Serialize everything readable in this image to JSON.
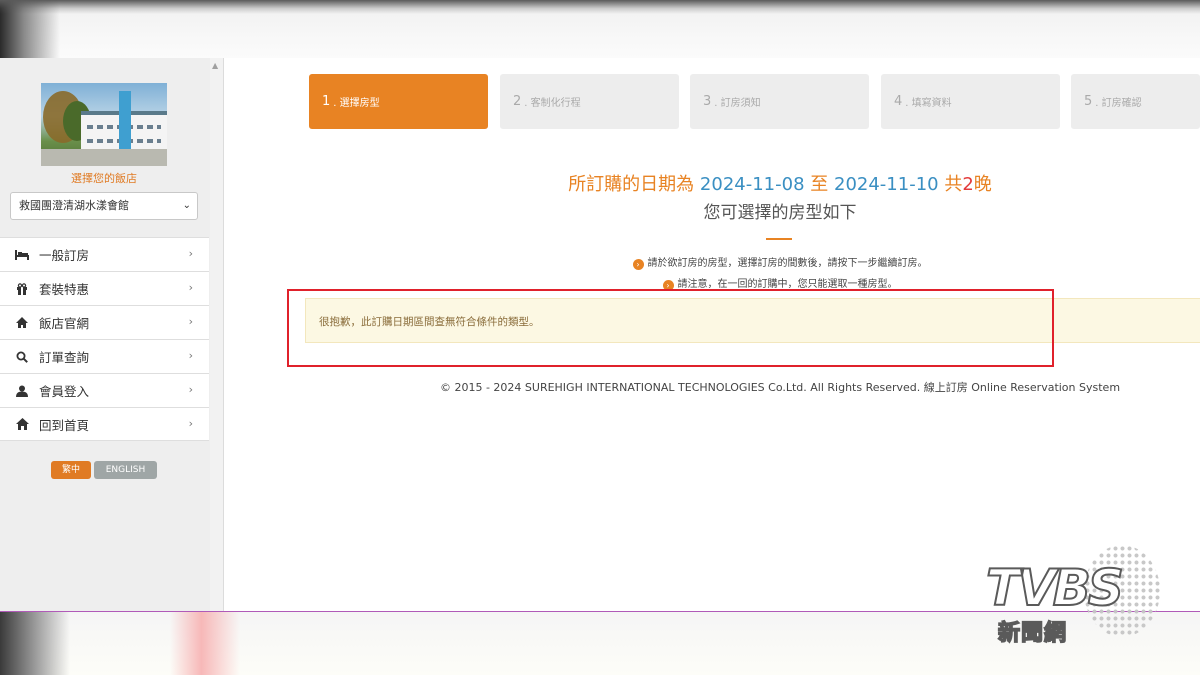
{
  "sidebar": {
    "choose_hotel_label": "選擇您的飯店",
    "selected_hotel": "救國團澄清湖水漾會館",
    "menu": [
      {
        "label": "一般訂房",
        "icon": "bed-icon"
      },
      {
        "label": "套裝特惠",
        "icon": "gift-icon"
      },
      {
        "label": "飯店官網",
        "icon": "house-icon"
      },
      {
        "label": "訂單查詢",
        "icon": "search-icon"
      },
      {
        "label": "會員登入",
        "icon": "user-icon"
      },
      {
        "label": "回到首頁",
        "icon": "home-icon"
      }
    ],
    "languages": {
      "zh": "繁中",
      "en": "ENGLISH"
    }
  },
  "steps": [
    {
      "num": "1",
      "label": ". 選擇房型",
      "active": true
    },
    {
      "num": "2",
      "label": ". 客制化行程",
      "active": false
    },
    {
      "num": "3",
      "label": ". 訂房須知",
      "active": false
    },
    {
      "num": "4",
      "label": ". 填寫資料",
      "active": false
    },
    {
      "num": "5",
      "label": ". 訂房確認",
      "active": false
    }
  ],
  "booking": {
    "prefix": "所訂購的日期為",
    "start_date": "2024-11-08",
    "to": "至",
    "end_date": "2024-11-10",
    "total_prefix": "共",
    "nights": "2",
    "nights_unit": "晚",
    "subtitle": "您可選擇的房型如下"
  },
  "notices": [
    "請於欲訂房的房型，選擇訂房的間數後，請按下一步繼續訂房。",
    "請注意，在一回的訂購中，您只能選取一種房型。"
  ],
  "alert_message": "很抱歉，此訂購日期區間查無符合條件的類型。",
  "footer": "© 2015 - 2024 SUREHIGH INTERNATIONAL TECHNOLOGIES Co.Ltd. All Rights Reserved. 線上訂房 Online Reservation System",
  "watermark": {
    "logo": "TVBS",
    "sub": "新聞網"
  },
  "colors": {
    "accent": "#e88323",
    "date_blue": "#3a8fc2",
    "nights_red": "#e33b3b",
    "highlight": "#e0212b"
  }
}
